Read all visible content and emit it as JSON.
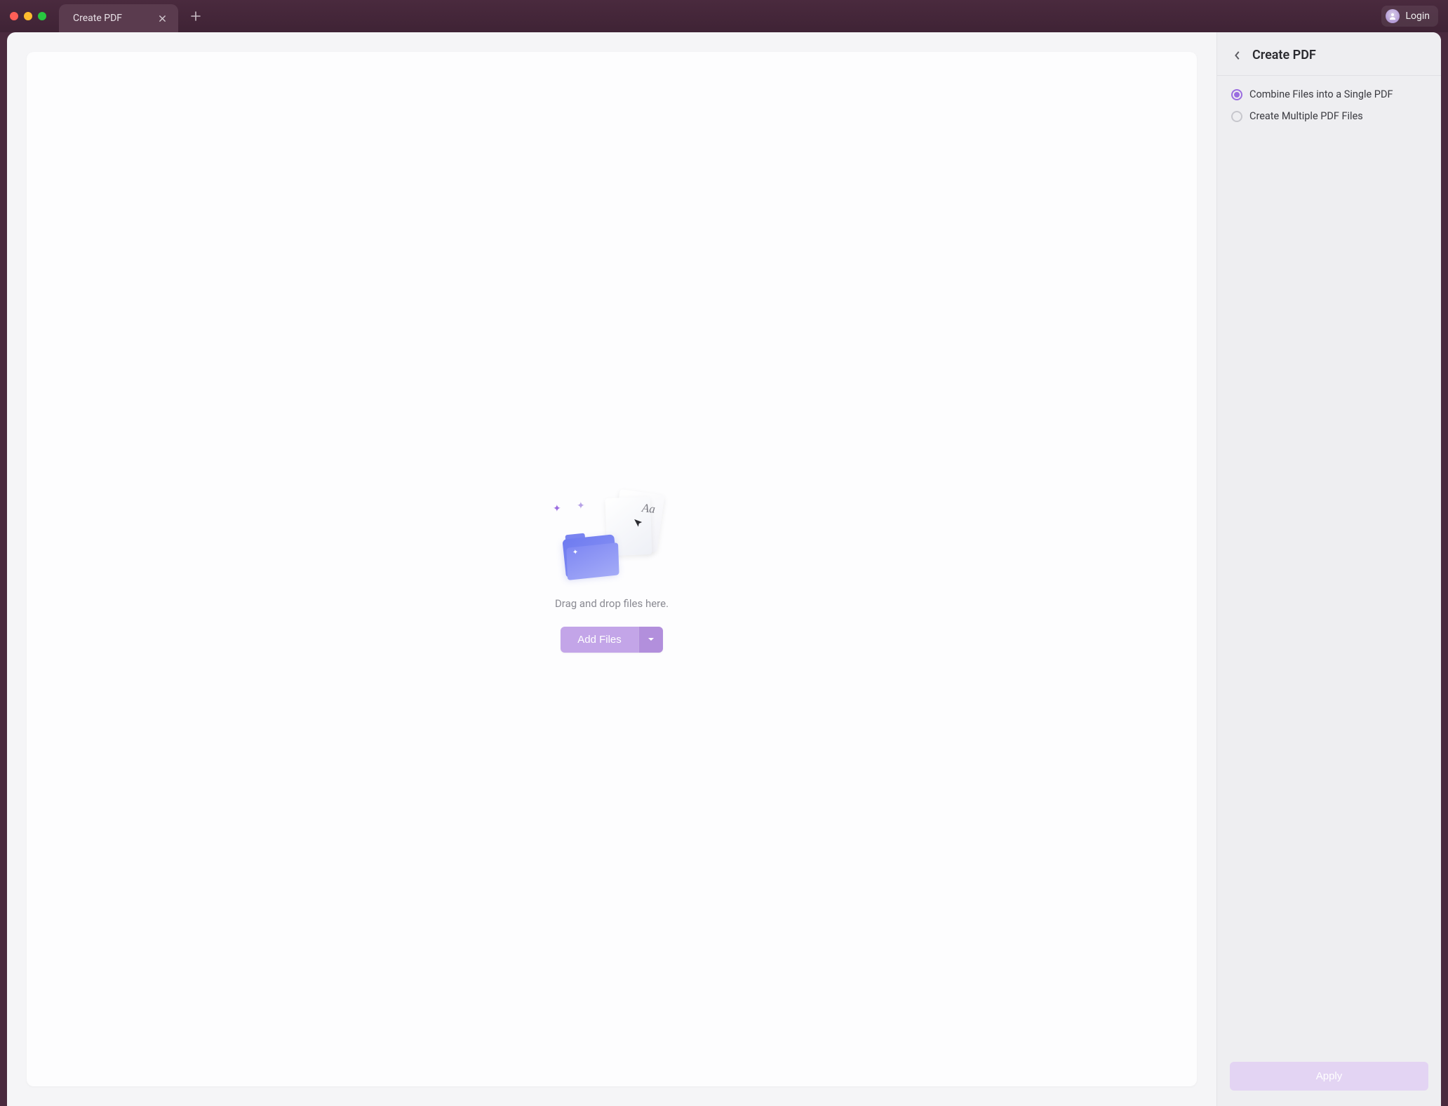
{
  "titlebar": {
    "tab_label": "Create PDF",
    "login_label": "Login"
  },
  "main": {
    "drop_hint": "Drag and drop files here.",
    "add_files_label": "Add Files",
    "illustration_text": "Aa"
  },
  "panel": {
    "title": "Create PDF",
    "options": [
      {
        "label": "Combine Files into a Single PDF",
        "selected": true
      },
      {
        "label": "Create Multiple PDF Files",
        "selected": false
      }
    ],
    "apply_label": "Apply"
  }
}
